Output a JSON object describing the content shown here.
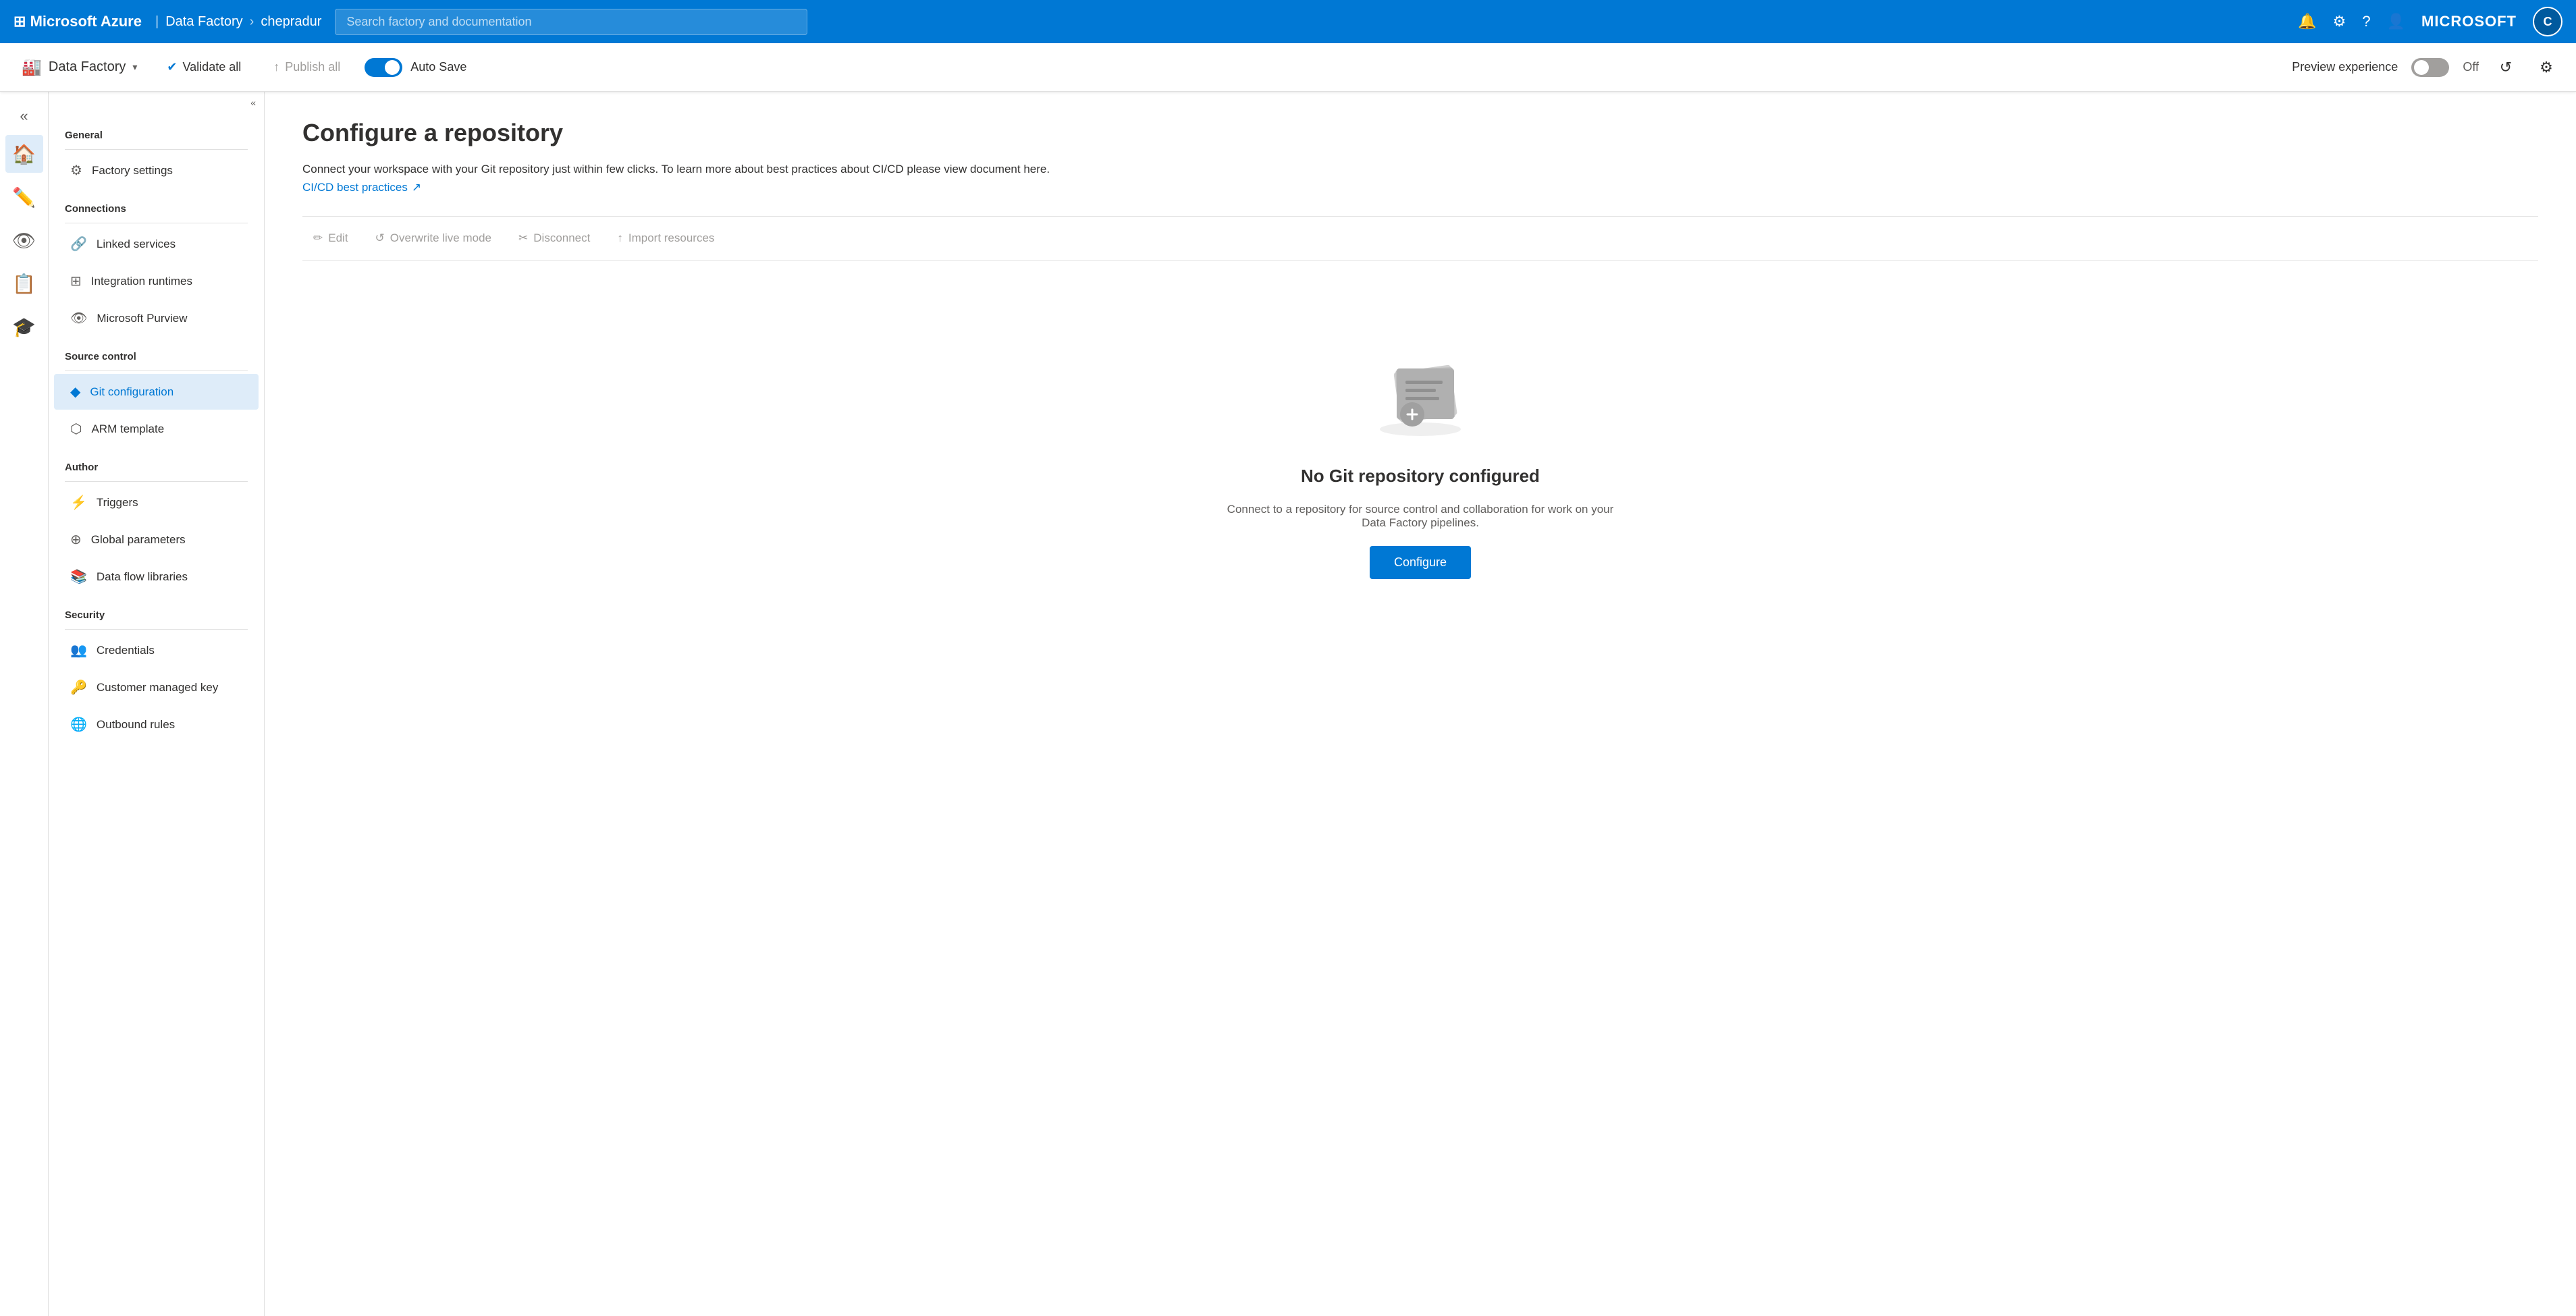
{
  "topbar": {
    "logo": "Microsoft Azure",
    "breadcrumb": [
      "Data Factory",
      "chepradur"
    ],
    "search_placeholder": "Search factory and documentation",
    "microsoft_label": "MICROSOFT"
  },
  "toolbar": {
    "factory_name": "Data Factory",
    "validate_label": "Validate all",
    "publish_label": "Publish all",
    "autosave_label": "Auto Save",
    "preview_label": "Preview experience",
    "off_label": "Off"
  },
  "sidebar": {
    "general_label": "General",
    "connections_label": "Connections",
    "source_control_label": "Source control",
    "author_label": "Author",
    "security_label": "Security",
    "items": {
      "factory_settings": "Factory settings",
      "linked_services": "Linked services",
      "integration_runtimes": "Integration runtimes",
      "microsoft_purview": "Microsoft Purview",
      "git_configuration": "Git configuration",
      "arm_template": "ARM template",
      "triggers": "Triggers",
      "global_parameters": "Global parameters",
      "data_flow_libraries": "Data flow libraries",
      "credentials": "Credentials",
      "customer_managed_key": "Customer managed key",
      "outbound_rules": "Outbound rules"
    }
  },
  "content": {
    "title": "Configure a repository",
    "description": "Connect your workspace with your Git repository just within few clicks. To learn more about best practices about CI/CD please view document here.",
    "link_label": "CI/CD best practices",
    "actions": {
      "edit": "Edit",
      "overwrite_live": "Overwrite live mode",
      "disconnect": "Disconnect",
      "import_resources": "Import resources"
    },
    "empty_state": {
      "title": "No Git repository configured",
      "description": "Connect to a repository for source control and collaboration for work on your Data Factory pipelines.",
      "configure_btn": "Configure"
    }
  }
}
